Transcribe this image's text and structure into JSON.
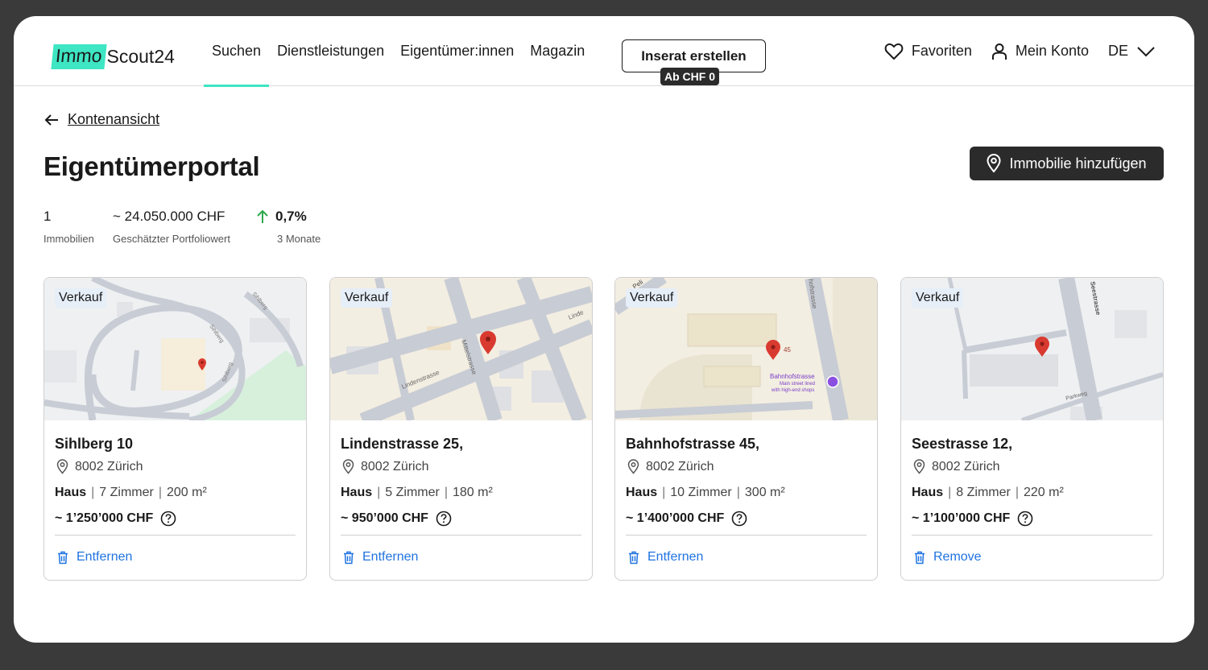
{
  "header": {
    "logo_immo": "Immo",
    "logo_scout": "Scout24",
    "nav": [
      {
        "label": "Suchen"
      },
      {
        "label": "Dienstleistungen"
      },
      {
        "label": "Eigentümer:innen"
      },
      {
        "label": "Magazin"
      }
    ],
    "cta_label": "Inserat erstellen",
    "cta_badge": "Ab CHF 0",
    "favorites": "Favoriten",
    "account": "Mein Konto",
    "language": "DE"
  },
  "back_link": "Kontenansicht",
  "page_title": "Eigentümerportal",
  "add_property_button": "Immobilie hinzufügen",
  "stats": {
    "count_value": "1",
    "count_label": "Immobilien",
    "value_value": "~ 24.050.000 CHF",
    "value_label": "Geschätzter Portfoliowert",
    "change_value": "0,7%",
    "change_label": "3 Monate"
  },
  "properties": [
    {
      "tag": "Verkauf",
      "address": "Sihlberg 10",
      "city": "8002 Zürich",
      "type": "Haus",
      "rooms": "7 Zimmer",
      "area": "200 m²",
      "price": "~ 1’250’000 CHF",
      "remove": "Entfernen"
    },
    {
      "tag": "Verkauf",
      "address": "Lindenstrasse 25,",
      "city": "8002 Zürich",
      "type": "Haus",
      "rooms": "5 Zimmer",
      "area": "180 m²",
      "price": "~ 950’000 CHF",
      "remove": "Entfernen"
    },
    {
      "tag": "Verkauf",
      "address": "Bahnhofstrasse 45,",
      "city": "8002 Zürich",
      "type": "Haus",
      "rooms": "10 Zimmer",
      "area": "300 m²",
      "price": "~ 1’400’000 CHF",
      "remove": "Entfernen"
    },
    {
      "tag": "Verkauf",
      "address": "Seestrasse 12,",
      "city": "8002 Zürich",
      "type": "Haus",
      "rooms": "8 Zimmer",
      "area": "220 m²",
      "price": "~ 1’100’000 CHF",
      "remove": "Remove"
    }
  ],
  "map_labels": {
    "m1": [
      "Sihlberg",
      "Sihlberg",
      "Sihlberg"
    ],
    "m2": [
      "Lindenstrasse",
      "Mittelstrasse",
      "Linde"
    ],
    "m3": [
      "hofstrasse",
      "45",
      "Bahnhofstrasse",
      "Main street lined",
      "with high-end shops",
      "Peli"
    ],
    "m4": [
      "Seestrasse",
      "Parkweg"
    ]
  },
  "colors": {
    "accent": "#3ee6c3",
    "link": "#1f73e0",
    "dark": "#2b2b2b",
    "up": "#2ea84a",
    "pin": "#d93a2f"
  }
}
